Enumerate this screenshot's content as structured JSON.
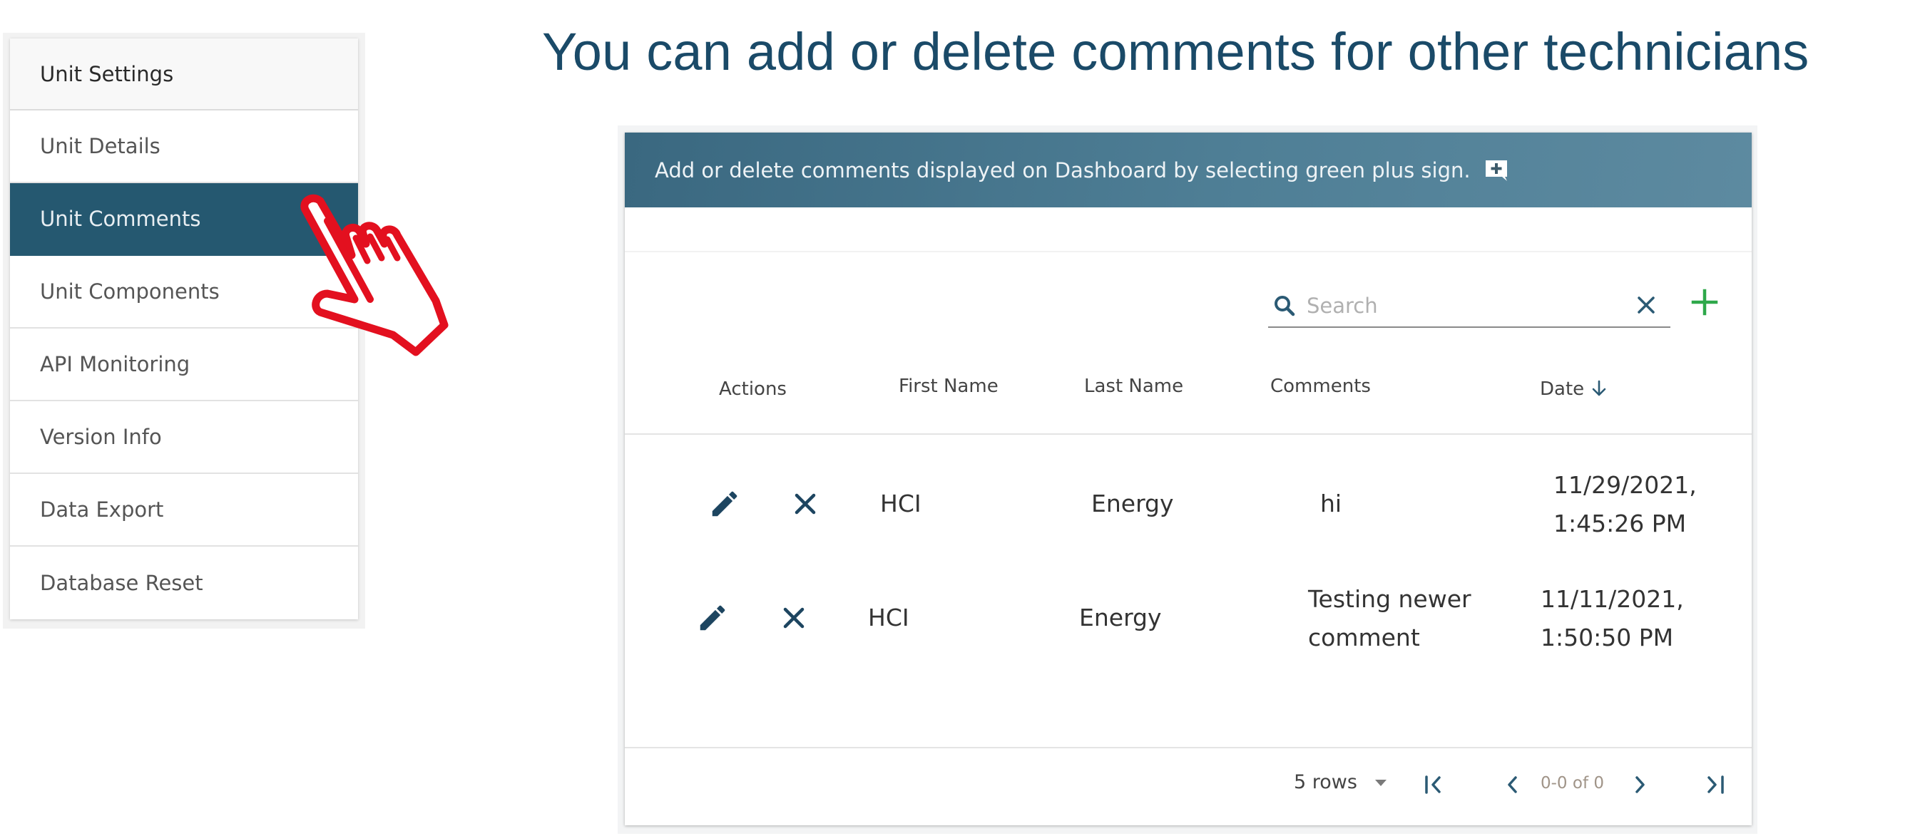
{
  "page_title": "You can add or delete comments for other technicians",
  "sidebar": {
    "header": "Unit Settings",
    "items": [
      {
        "label": "Unit Details",
        "active": false
      },
      {
        "label": "Unit Comments",
        "active": true
      },
      {
        "label": "Unit Components",
        "active": false
      },
      {
        "label": "API Monitoring",
        "active": false
      },
      {
        "label": "Version Info",
        "active": false
      },
      {
        "label": "Data Export",
        "active": false
      },
      {
        "label": "Database Reset",
        "active": false
      }
    ]
  },
  "pointer": {
    "icon": "hand-pointer-icon",
    "color": "#e3101f"
  },
  "card": {
    "header_text": "Add or delete comments displayed on Dashboard by selecting green plus sign.",
    "header_icon": "add-comment-icon",
    "search": {
      "placeholder": "Search",
      "value": ""
    },
    "add_button_color": "#2ea84a",
    "columns": [
      "Actions",
      "First Name",
      "Last Name",
      "Comments",
      "Date"
    ],
    "sort": {
      "column": "Date",
      "direction": "descending"
    },
    "rows": [
      {
        "first_name": "HCI",
        "last_name": "Energy",
        "comment": [
          "hi"
        ],
        "date": [
          "11/29/2021,",
          "1:45:26 PM"
        ]
      },
      {
        "first_name": "HCI",
        "last_name": "Energy",
        "comment": [
          "Testing newer",
          "comment"
        ],
        "date": [
          "11/11/2021,",
          "1:50:50 PM"
        ]
      }
    ],
    "pagination": {
      "rows_per_page": "5 rows",
      "range": "0-0 of 0"
    }
  },
  "colors": {
    "title": "#1a4a68",
    "sidebar_active": "#255870",
    "icon_dark": "#1d4560",
    "header_gradient_start": "#3a6880",
    "header_gradient_end": "#5d8aa0"
  }
}
